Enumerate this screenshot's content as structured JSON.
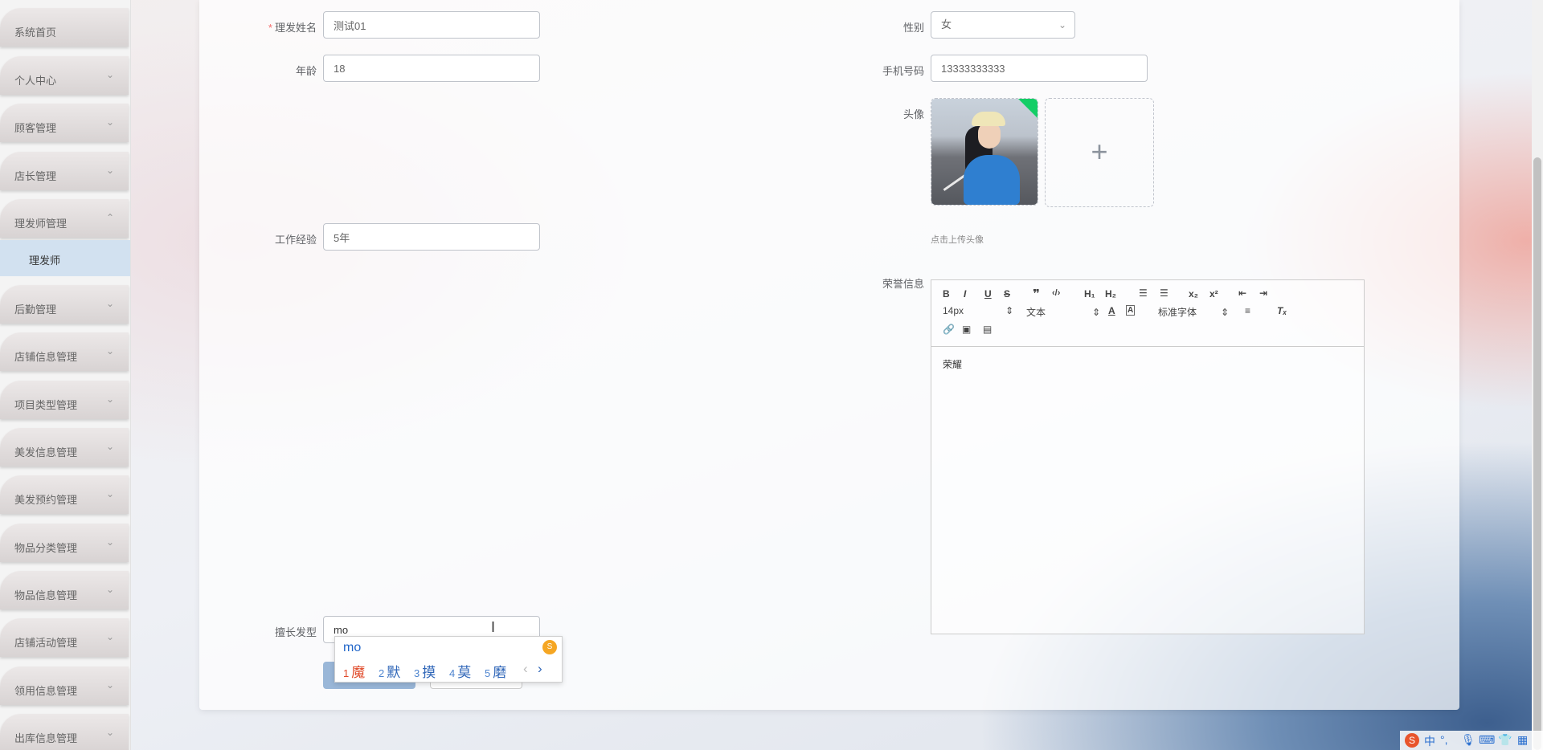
{
  "sidebar": {
    "items": [
      {
        "label": "系统首页",
        "chevron": ""
      },
      {
        "label": "个人中心",
        "chevron": "⌄"
      },
      {
        "label": "顾客管理",
        "chevron": "⌄"
      },
      {
        "label": "店长管理",
        "chevron": "⌄"
      },
      {
        "label": "理发师管理",
        "chevron": "⌃"
      },
      {
        "label": "后勤管理",
        "chevron": "⌄"
      },
      {
        "label": "店铺信息管理",
        "chevron": "⌄"
      },
      {
        "label": "项目类型管理",
        "chevron": "⌄"
      },
      {
        "label": "美发信息管理",
        "chevron": "⌄"
      },
      {
        "label": "美发预约管理",
        "chevron": "⌄"
      },
      {
        "label": "物品分类管理",
        "chevron": "⌄"
      },
      {
        "label": "物品信息管理",
        "chevron": "⌄"
      },
      {
        "label": "店铺活动管理",
        "chevron": "⌄"
      },
      {
        "label": "领用信息管理",
        "chevron": "⌄"
      },
      {
        "label": "出库信息管理",
        "chevron": "⌄"
      }
    ],
    "subitem": "理发师"
  },
  "form": {
    "required_mark": "*",
    "name_label": "理发姓名",
    "name_value": "测试01",
    "gender_label": "性别",
    "gender_value": "女",
    "age_label": "年龄",
    "age_value": "18",
    "phone_label": "手机号码",
    "phone_value": "13333333333",
    "avatar_label": "头像",
    "avatar_hint": "点击上传头像",
    "experience_label": "工作经验",
    "experience_value": "5年",
    "honor_label": "荣誉信息",
    "specialty_label": "擅长发型",
    "specialty_value": "mo"
  },
  "editor": {
    "font_size": "14px",
    "text_style": "文本",
    "font_family": "标准字体",
    "content": "荣耀"
  },
  "ime": {
    "composition": "mo",
    "candidates": [
      {
        "n": "1",
        "c": "魔"
      },
      {
        "n": "2",
        "c": "默"
      },
      {
        "n": "3",
        "c": "摸"
      },
      {
        "n": "4",
        "c": "莫"
      },
      {
        "n": "5",
        "c": "磨"
      }
    ],
    "prev": "‹",
    "next": "›"
  },
  "tray": {
    "ime_lang": "中",
    "punct": "°,"
  }
}
